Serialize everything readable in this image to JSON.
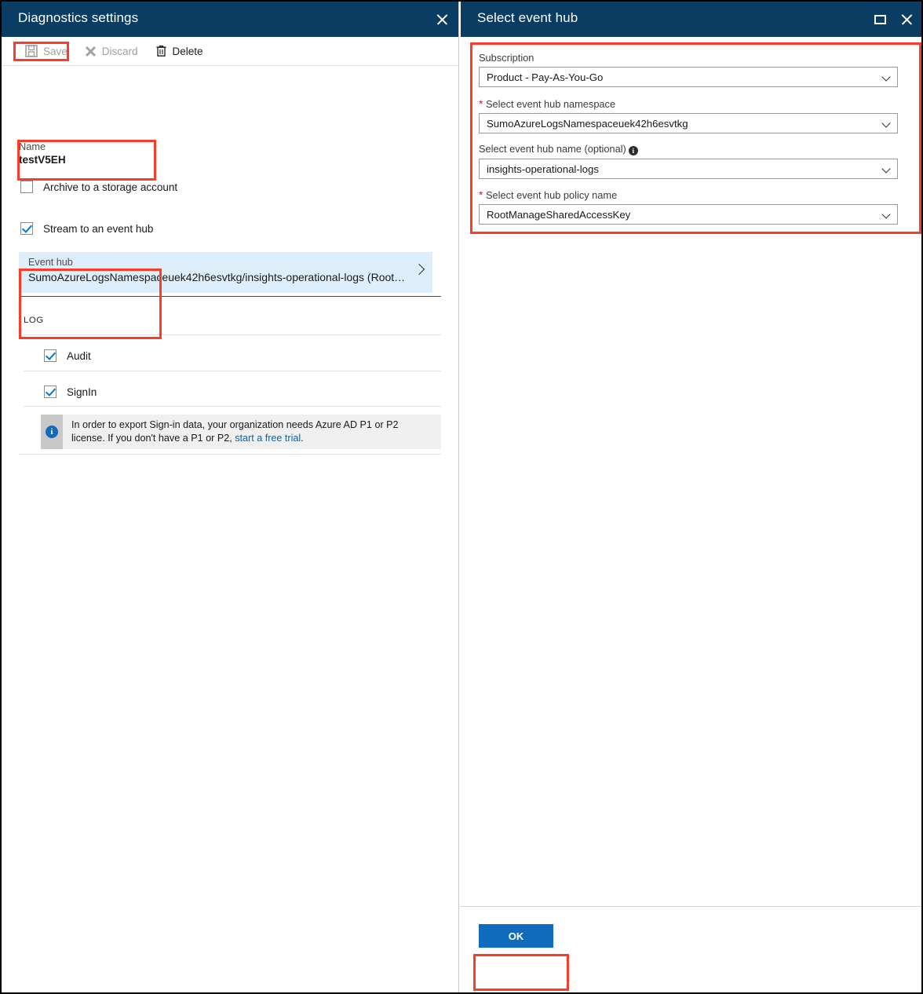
{
  "colors": {
    "blade_header": "#0b3d63",
    "accent": "#0f6cbd",
    "annotation": "#fa3c28",
    "link": "#0065b3",
    "selected_tile": "#deeefb",
    "required_star": "#e81123"
  },
  "left_blade": {
    "title": "Diagnostics settings",
    "close_icon": "close-icon",
    "toolbar": {
      "save_label": "Save",
      "save_icon": "save-disk-icon",
      "save_enabled": false,
      "discard_label": "Discard",
      "discard_icon": "discard-x-icon",
      "discard_enabled": false,
      "delete_label": "Delete",
      "delete_icon": "trash-icon",
      "delete_enabled": true
    },
    "name_label": "Name",
    "name_value": "testV5EH",
    "archive_checkbox": {
      "label": "Archive to a storage account",
      "checked": false
    },
    "stream_checkbox": {
      "label": "Stream to an event hub",
      "checked": true
    },
    "event_hub_tile": {
      "caption": "Event hub",
      "value": "SumoAzureLogsNamespaceuek42h6esvtkg/insights-operational-logs (Root…",
      "chevron_icon": "chevron-right-icon"
    },
    "log_section_header": "LOG",
    "log_rows": [
      {
        "label": "Audit",
        "checked": true
      },
      {
        "label": "SignIn",
        "checked": true
      }
    ],
    "info_banner": {
      "icon": "info-circle-icon",
      "text_part1": "In order to export Sign-in data, your organization needs Azure AD P1 or P2 license. If you don't have a P1 or P2, ",
      "link_text": "start a free trial",
      "text_part2": "."
    }
  },
  "right_blade": {
    "title": "Select event hub",
    "restore_icon": "restore-window-icon",
    "close_icon": "close-icon",
    "fields": [
      {
        "label": "Subscription",
        "required": false,
        "has_info": false,
        "value": "Product - Pay-As-You-Go",
        "chevron_icon": "chevron-down-icon"
      },
      {
        "label": "Select event hub namespace",
        "required": true,
        "has_info": false,
        "value": "SumoAzureLogsNamespaceuek42h6esvtkg",
        "chevron_icon": "chevron-down-icon"
      },
      {
        "label": "Select event hub name (optional)",
        "required": false,
        "has_info": true,
        "value": "insights-operational-logs",
        "chevron_icon": "chevron-down-icon"
      },
      {
        "label": "Select event hub policy name",
        "required": true,
        "has_info": false,
        "value": "RootManageSharedAccessKey",
        "chevron_icon": "chevron-down-icon"
      }
    ],
    "ok_label": "OK"
  },
  "annotations": {
    "count": 6,
    "labels": [
      "save-button-highlight",
      "stream-to-event-hub-highlight",
      "log-checkboxes-highlight",
      "event-hub-fields-highlight",
      "ok-button-highlight"
    ]
  }
}
